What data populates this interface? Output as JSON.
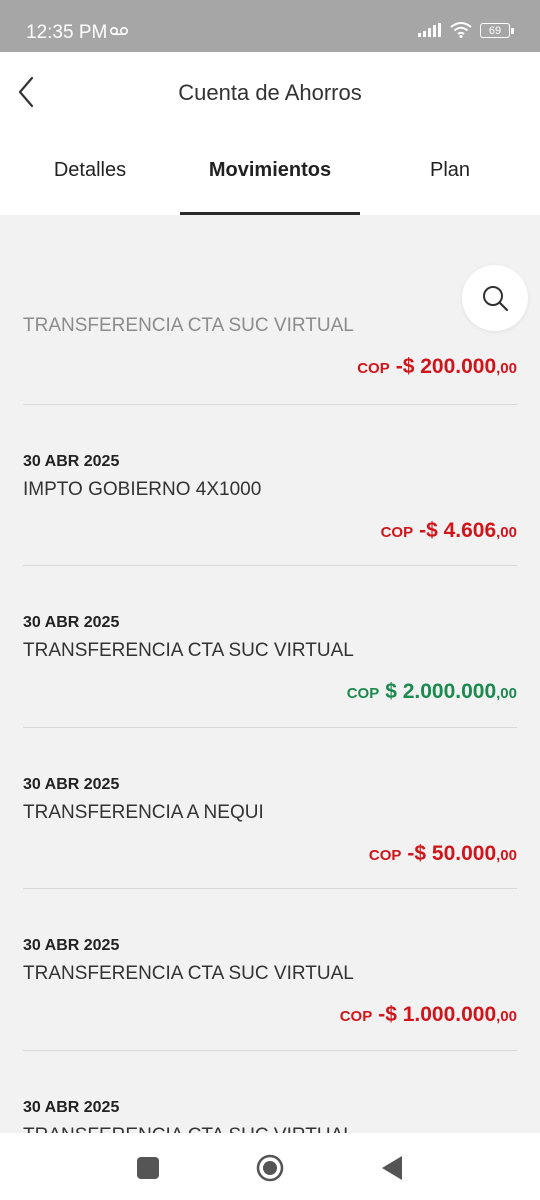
{
  "status_bar": {
    "time": "12:35 PM",
    "battery": "69",
    "icons": [
      "voicemail-icon",
      "signal-icon",
      "wifi-icon",
      "battery-icon"
    ]
  },
  "header": {
    "title": "Cuenta de Ahorros",
    "back_icon": "chevron-left-icon"
  },
  "tabs": [
    {
      "label": "Detalles",
      "active": false
    },
    {
      "label": "Movimientos",
      "active": true
    },
    {
      "label": "Plan",
      "active": false
    }
  ],
  "search": {
    "icon": "search-icon"
  },
  "transactions": [
    {
      "date": "",
      "description": "TRANSFERENCIA CTA SUC VIRTUAL",
      "currency": "COP",
      "amount": "-$ 200.000",
      "decimals": ",00",
      "type": "debit"
    },
    {
      "date": "30 ABR 2025",
      "description": "IMPTO GOBIERNO 4X1000",
      "currency": "COP",
      "amount": "-$ 4.606",
      "decimals": ",00",
      "type": "debit"
    },
    {
      "date": "30 ABR 2025",
      "description": "TRANSFERENCIA CTA SUC VIRTUAL",
      "currency": "COP",
      "amount": "$ 2.000.000",
      "decimals": ",00",
      "type": "credit"
    },
    {
      "date": "30 ABR 2025",
      "description": "TRANSFERENCIA A NEQUI",
      "currency": "COP",
      "amount": "-$ 50.000",
      "decimals": ",00",
      "type": "debit"
    },
    {
      "date": "30 ABR 2025",
      "description": "TRANSFERENCIA CTA SUC VIRTUAL",
      "currency": "COP",
      "amount": "-$ 1.000.000",
      "decimals": ",00",
      "type": "debit"
    },
    {
      "date": "30 ABR 2025",
      "description": "TRANSFERENCIA CTA SUC VIRTUAL",
      "currency": "",
      "amount": "",
      "decimals": "",
      "type": "debit"
    }
  ],
  "colors": {
    "debit": "#d0151b",
    "credit": "#1b8a4f",
    "background": "#f2f2f3",
    "status_bar": "#a6a6a6"
  },
  "nav_bar": {
    "icons": [
      "recent-apps-icon",
      "home-icon",
      "back-icon"
    ]
  }
}
